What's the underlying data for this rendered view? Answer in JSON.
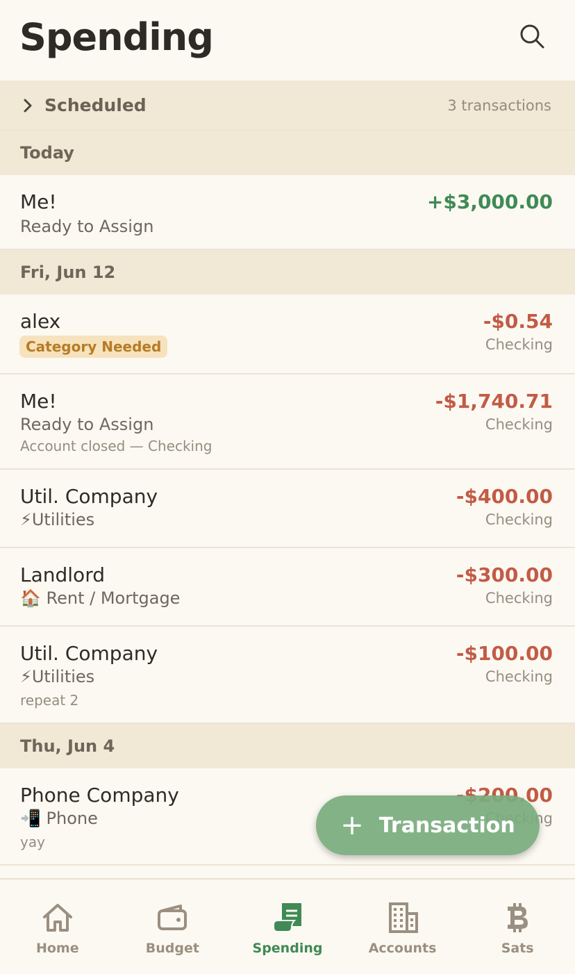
{
  "header": {
    "title": "Spending"
  },
  "scheduled": {
    "label": "Scheduled",
    "count": "3 transactions"
  },
  "groups": [
    {
      "date": "Today",
      "rows": [
        {
          "payee": "Me!",
          "category": "Ready to Assign",
          "amount": "+$3,000.00"
        }
      ]
    },
    {
      "date": "Fri, Jun 12",
      "rows": [
        {
          "payee": "alex",
          "badge": "Category Needed",
          "amount": "-$0.54",
          "account": "Checking"
        },
        {
          "payee": "Me!",
          "category": "Ready to Assign",
          "memo": "Account closed — Checking",
          "amount": "-$1,740.71",
          "account": "Checking"
        },
        {
          "payee": "Util. Company",
          "category": "⚡Utilities",
          "amount": "-$400.00",
          "account": "Checking"
        },
        {
          "payee": "Landlord",
          "category": "🏠 Rent / Mortgage",
          "amount": "-$300.00",
          "account": "Checking"
        },
        {
          "payee": "Util. Company",
          "category": "⚡Utilities",
          "memo": "repeat 2",
          "amount": "-$100.00",
          "account": "Checking"
        }
      ]
    },
    {
      "date": "Thu, Jun 4",
      "rows": [
        {
          "payee": "Phone Company",
          "category": "📲 Phone",
          "memo": "yay",
          "amount": "-$200.00",
          "account": "Checking"
        }
      ]
    }
  ],
  "fab": {
    "label": "Transaction"
  },
  "tabs": [
    {
      "label": "Home",
      "icon": "home-icon"
    },
    {
      "label": "Budget",
      "icon": "wallet-icon"
    },
    {
      "label": "Spending",
      "icon": "receipt-icon",
      "active": true
    },
    {
      "label": "Accounts",
      "icon": "building-icon"
    },
    {
      "label": "Sats",
      "icon": "bitcoin-icon"
    }
  ],
  "colors": {
    "positive": "#3f8a55",
    "negative": "#c25b46",
    "accent": "#3f8a55",
    "section_bg": "#f1e8d6",
    "page_bg": "#fcf9f2",
    "badge_bg": "#f6e2bd",
    "badge_text": "#b77b24"
  }
}
